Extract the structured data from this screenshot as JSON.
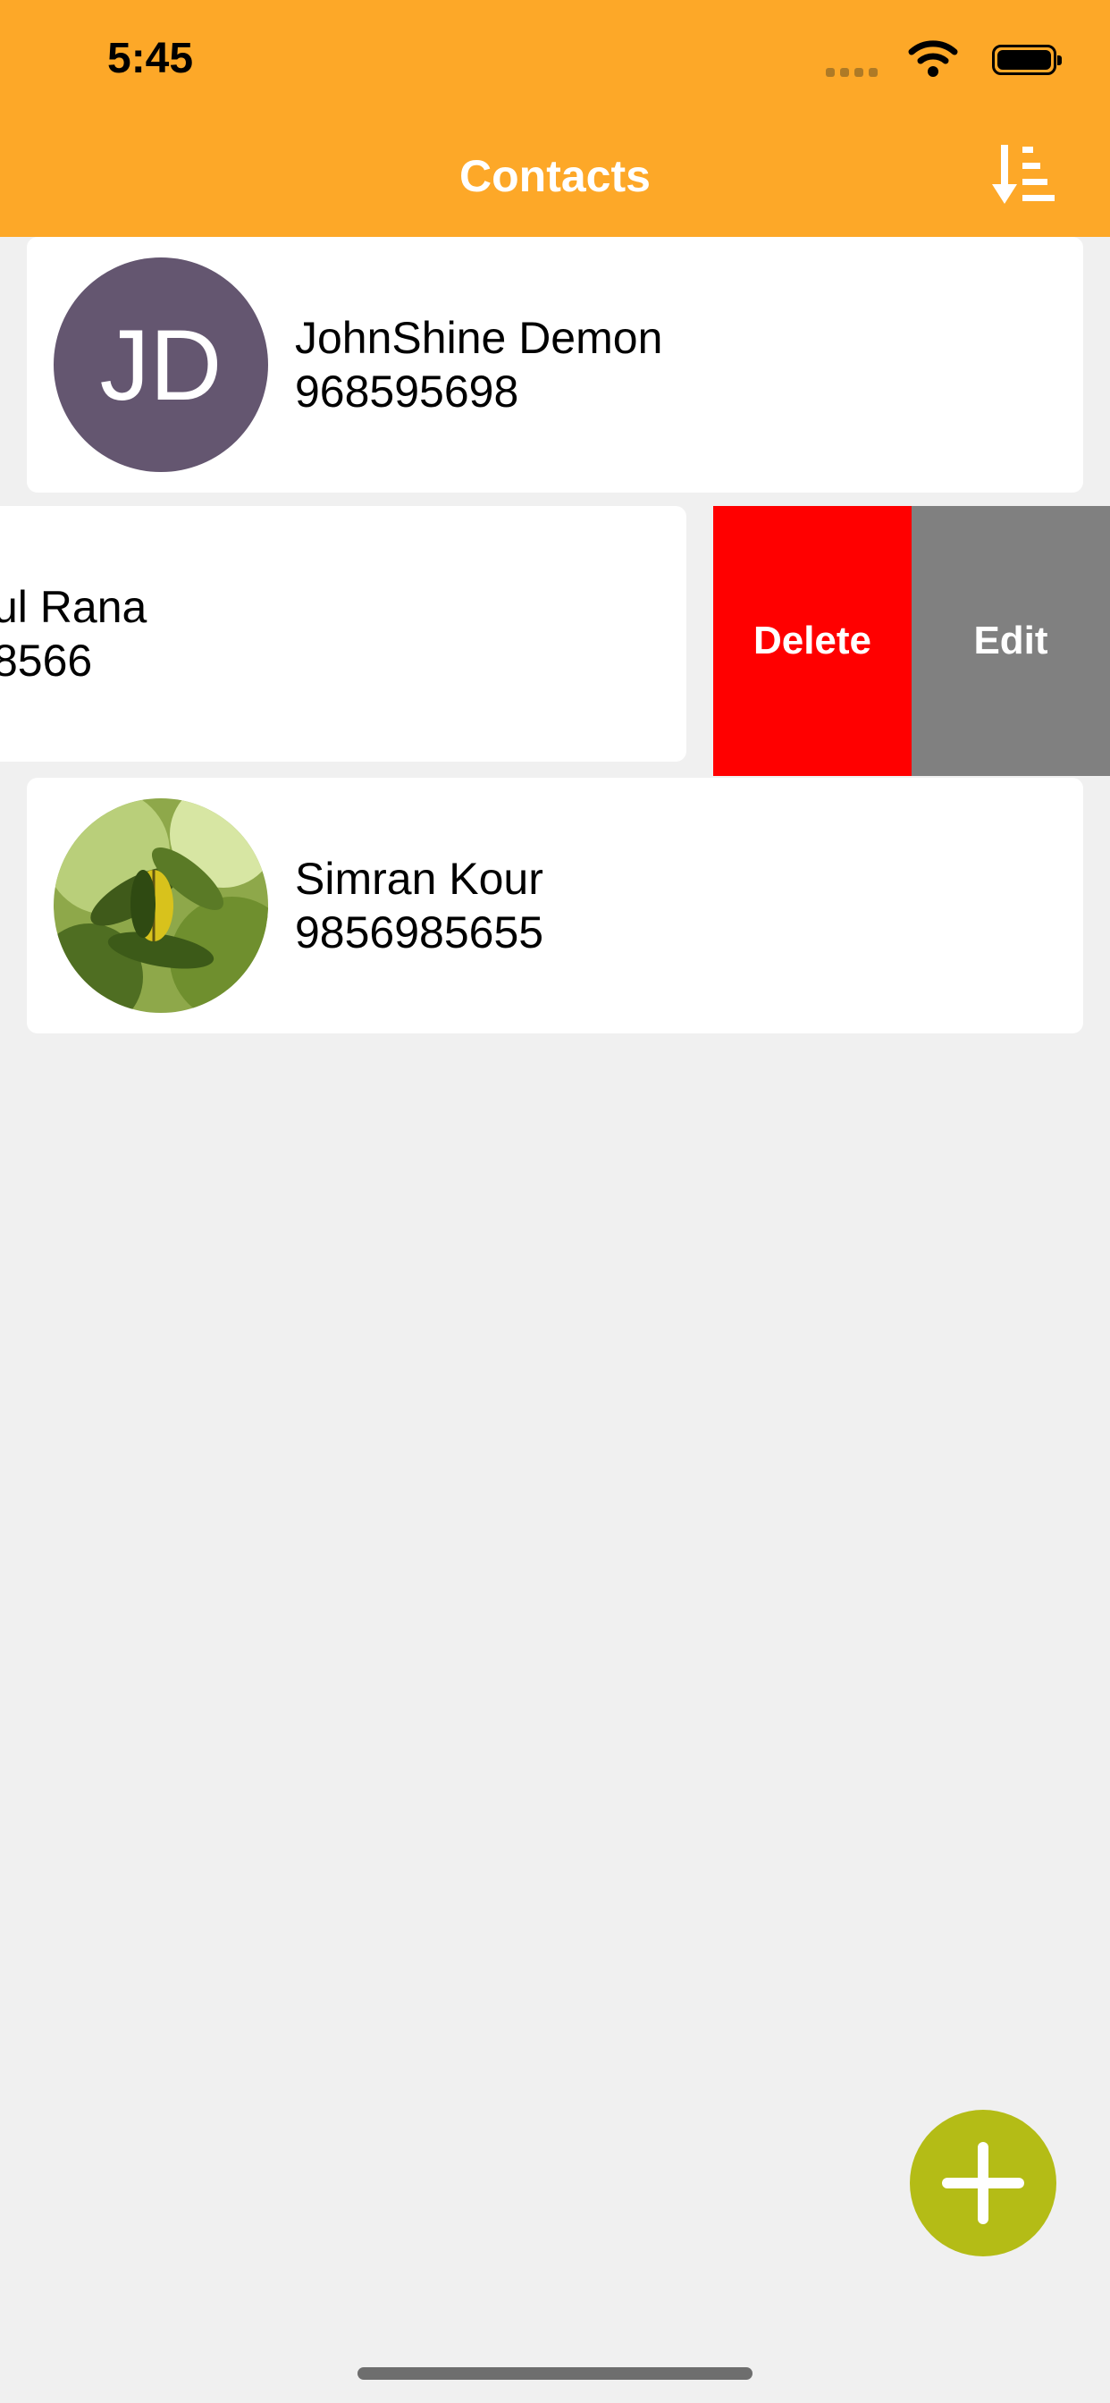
{
  "status_bar": {
    "time": "5:45"
  },
  "nav": {
    "title": "Contacts",
    "sort_icon": "sort-descending-icon"
  },
  "contacts": [
    {
      "initials": "JD",
      "name": "JohnShine Demon",
      "phone": "968595698",
      "avatar_color": "#645670"
    },
    {
      "name": "ul Rana",
      "phone": "8566"
    },
    {
      "name": "Simran Kour",
      "phone": "9856985655",
      "avatar": "leaf-photo"
    }
  ],
  "swipe_actions": {
    "delete_label": "Delete",
    "edit_label": "Edit",
    "delete_color": "#ff0000",
    "edit_color": "#808080"
  },
  "fab": {
    "icon": "plus-icon",
    "color": "#b4bc16"
  },
  "colors": {
    "header": "#fda828",
    "background": "#f0f0f0"
  }
}
